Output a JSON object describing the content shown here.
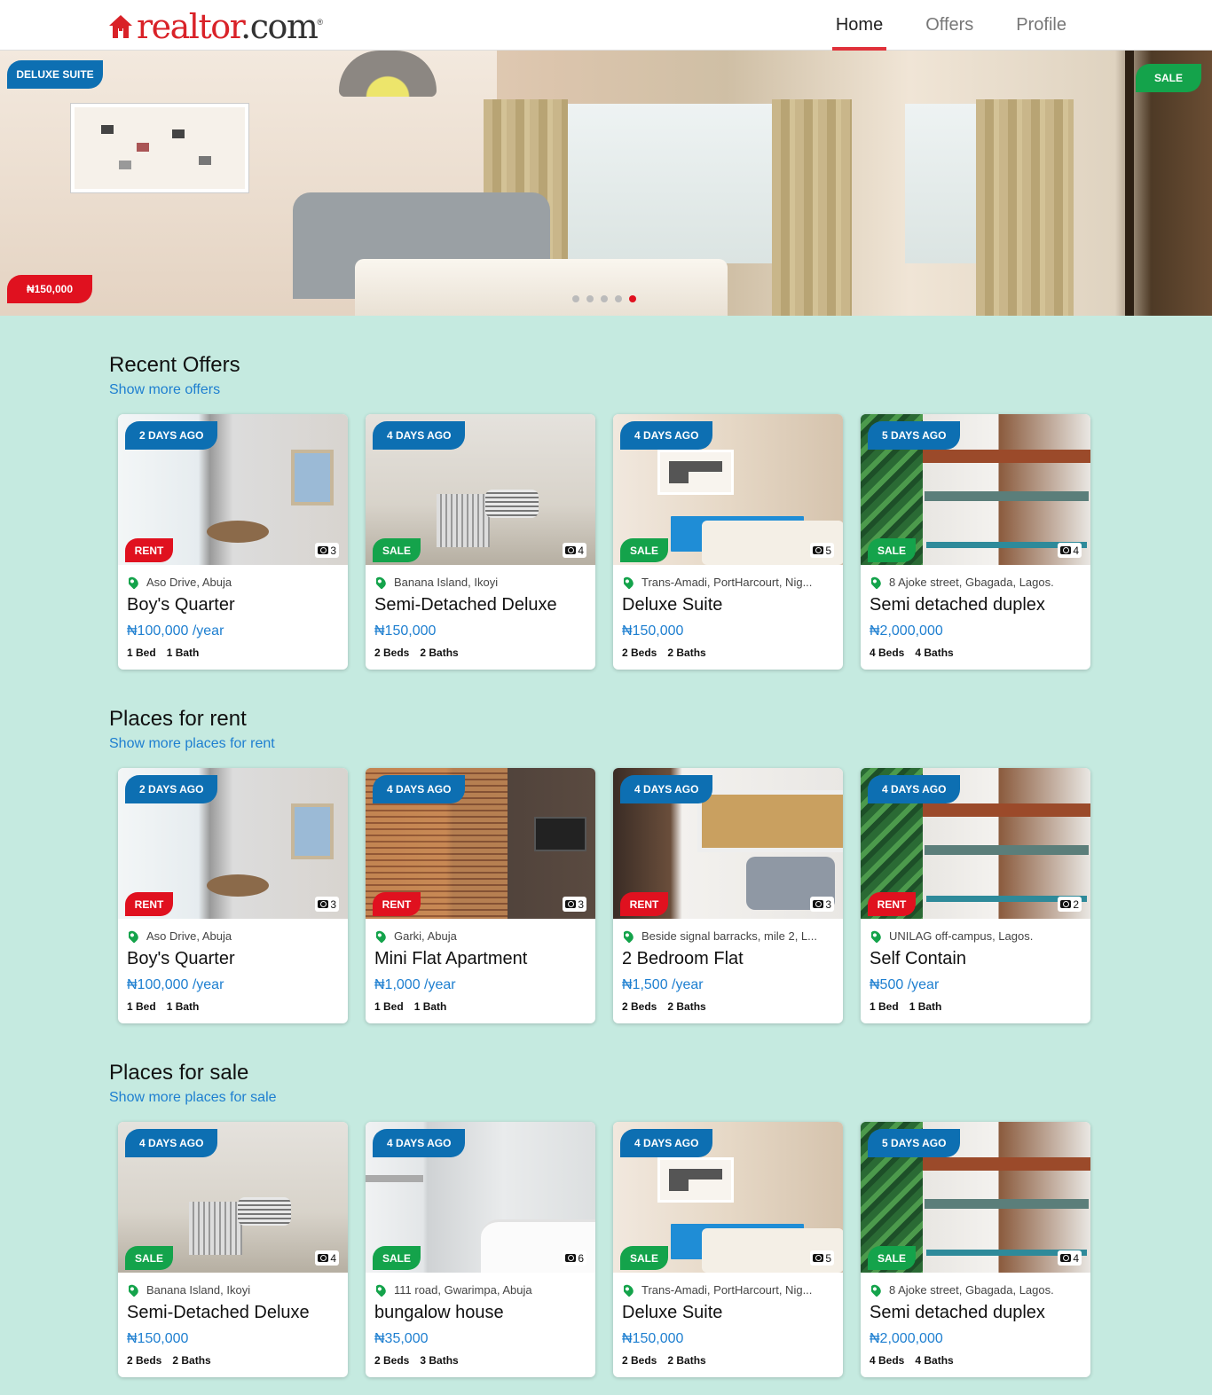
{
  "header": {
    "logo_text_red": "realtor",
    "logo_text_dark": ".com",
    "logo_reg": "®",
    "nav": [
      {
        "label": "Home",
        "active": true
      },
      {
        "label": "Offers",
        "active": false
      },
      {
        "label": "Profile",
        "active": false
      }
    ]
  },
  "hero": {
    "name_tag": "DELUXE SUITE",
    "price_tag": "₦150,000",
    "status_tag": "SALE",
    "slides": 5,
    "active_slide": 5
  },
  "sections": [
    {
      "title": "Recent Offers",
      "link": "Show more offers",
      "cards": [
        {
          "ago": "2 DAYS AGO",
          "status": "RENT",
          "photos": "3",
          "location": "Aso Drive, Abuja",
          "title": "Boy's Quarter",
          "price": "₦100,000 /year",
          "beds": "1 Bed",
          "baths": "1 Bath",
          "image": "boys"
        },
        {
          "ago": "4 DAYS AGO",
          "status": "SALE",
          "photos": "4",
          "location": "Banana Island, Ikoyi",
          "title": "Semi-Detached Deluxe",
          "price": "₦150,000",
          "beds": "2 Beds",
          "baths": "2 Baths",
          "image": "semi"
        },
        {
          "ago": "4 DAYS AGO",
          "status": "SALE",
          "photos": "5",
          "location": "Trans-Amadi, PortHarcourt, Nig...",
          "title": "Deluxe Suite",
          "price": "₦150,000",
          "beds": "2 Beds",
          "baths": "2 Baths",
          "image": "deluxe"
        },
        {
          "ago": "5 DAYS AGO",
          "status": "SALE",
          "photos": "4",
          "location": "8 Ajoke street, Gbagada, Lagos.",
          "title": "Semi detached duplex",
          "price": "₦2,000,000",
          "beds": "4 Beds",
          "baths": "4 Baths",
          "image": "duplex"
        }
      ]
    },
    {
      "title": "Places for rent",
      "link": "Show more places for rent",
      "cards": [
        {
          "ago": "2 DAYS AGO",
          "status": "RENT",
          "photos": "3",
          "location": "Aso Drive, Abuja",
          "title": "Boy's Quarter",
          "price": "₦100,000 /year",
          "beds": "1 Bed",
          "baths": "1 Bath",
          "image": "boys"
        },
        {
          "ago": "4 DAYS AGO",
          "status": "RENT",
          "photos": "3",
          "location": "Garki, Abuja",
          "title": "Mini Flat Apartment",
          "price": "₦1,000 /year",
          "beds": "1 Bed",
          "baths": "1 Bath",
          "image": "mini"
        },
        {
          "ago": "4 DAYS AGO",
          "status": "RENT",
          "photos": "3",
          "location": "Beside signal barracks, mile 2, L...",
          "title": "2 Bedroom Flat",
          "price": "₦1,500 /year",
          "beds": "2 Beds",
          "baths": "2 Baths",
          "image": "2bed"
        },
        {
          "ago": "4 DAYS AGO",
          "status": "RENT",
          "photos": "2",
          "location": "UNILAG off-campus, Lagos.",
          "title": "Self Contain",
          "price": "₦500 /year",
          "beds": "1 Bed",
          "baths": "1 Bath",
          "image": "self"
        }
      ]
    },
    {
      "title": "Places for sale",
      "link": "Show more places for sale",
      "cards": [
        {
          "ago": "4 DAYS AGO",
          "status": "SALE",
          "photos": "4",
          "location": "Banana Island, Ikoyi",
          "title": "Semi-Detached Deluxe",
          "price": "₦150,000",
          "beds": "2 Beds",
          "baths": "2 Baths",
          "image": "semi"
        },
        {
          "ago": "4 DAYS AGO",
          "status": "SALE",
          "photos": "6",
          "location": "111 road, Gwarimpa, Abuja",
          "title": "bungalow house",
          "price": "₦35,000",
          "beds": "2 Beds",
          "baths": "3 Baths",
          "image": "bungalow"
        },
        {
          "ago": "4 DAYS AGO",
          "status": "SALE",
          "photos": "5",
          "location": "Trans-Amadi, PortHarcourt, Nig...",
          "title": "Deluxe Suite",
          "price": "₦150,000",
          "beds": "2 Beds",
          "baths": "2 Baths",
          "image": "deluxe"
        },
        {
          "ago": "5 DAYS AGO",
          "status": "SALE",
          "photos": "4",
          "location": "8 Ajoke street, Gbagada, Lagos.",
          "title": "Semi detached duplex",
          "price": "₦2,000,000",
          "beds": "4 Beds",
          "baths": "4 Baths",
          "image": "duplex"
        }
      ]
    }
  ],
  "colors": {
    "brand_red": "#d92228",
    "accent_blue": "#0d6fb2",
    "link_blue": "#1e7fd0",
    "rent_red": "#e0111f",
    "sale_green": "#14a34b",
    "page_bg": "#c5eae0"
  },
  "icons": {
    "location": "map-pin-icon",
    "photos": "camera-icon",
    "logo": "house-logo-icon"
  }
}
